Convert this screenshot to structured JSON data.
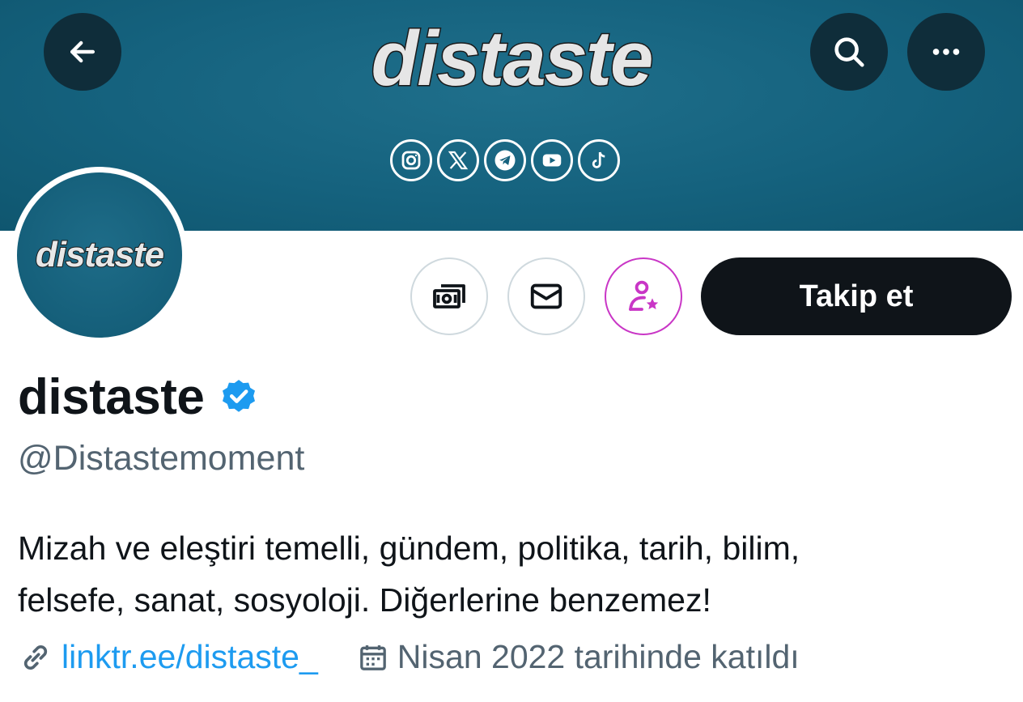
{
  "banner": {
    "logo_text": "distaste",
    "background_color": "#15627e",
    "socials": [
      "instagram-icon",
      "x-icon",
      "telegram-icon",
      "youtube-icon",
      "tiktok-icon"
    ]
  },
  "header_actions": {
    "back": "arrow-left-icon",
    "search": "search-icon",
    "more": "more-horizontal-icon"
  },
  "avatar": {
    "text": "distaste"
  },
  "profile_actions": {
    "subscribe_icon": "money-icon",
    "message_icon": "envelope-icon",
    "subscribe_creator_icon": "person-star-icon",
    "follow_label": "Takip et"
  },
  "profile": {
    "display_name": "distaste",
    "verified": true,
    "handle": "@Distastemoment",
    "bio_lines": [
      "Mizah ve eleştiri temelli, gündem, politika, tarih, bilim,",
      "felsefe, sanat, sosyoloji. Diğerlerine benzemez!"
    ],
    "website": "linktr.ee/distaste_",
    "joined": "Nisan 2022 tarihinde katıldı"
  },
  "colors": {
    "accent_blue": "#1d9bf0",
    "follow_button": "#0f1419",
    "secondary_text": "#536471",
    "pink": "#c936c6"
  }
}
